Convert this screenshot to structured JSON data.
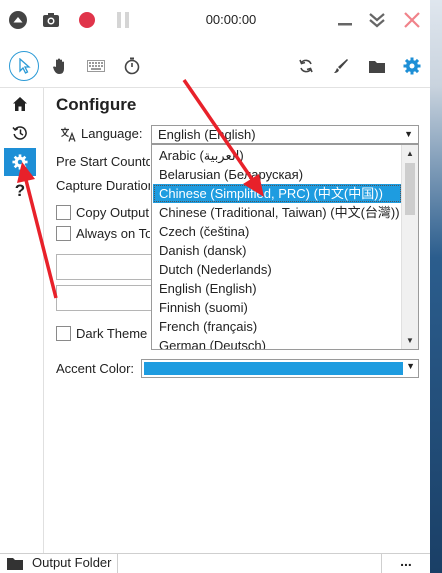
{
  "timer": "00:00:00",
  "page_title": "Configure",
  "language": {
    "label": "Language:",
    "selected": "English (English)",
    "options": [
      "Arabic (العربية)",
      "Belarusian (Беларуская)",
      "Chinese (Simplified, PRC) (中文(中国))",
      "Chinese (Traditional, Taiwan) (中文(台灣))",
      "Czech (čeština)",
      "Danish (dansk)",
      "Dutch (Nederlands)",
      "English (English)",
      "Finnish (suomi)",
      "French (français)",
      "German (Deutsch)"
    ],
    "highlighted_index": 2
  },
  "settings": {
    "pre_start": "Pre Start Countdown",
    "capture_duration": "Capture Duration",
    "copy_output": "Copy Output",
    "always_on_top": "Always on Top",
    "dark_theme": "Dark Theme",
    "accent_color": "Accent Color:"
  },
  "colors": {
    "accent": "#1e9ce0",
    "record": "#e0344a",
    "close": "#f0828a",
    "arrow": "#e8212a"
  },
  "bottom": {
    "output_folder": "Output Folder",
    "more": "..."
  },
  "icons": [
    "up-icon",
    "camera-icon",
    "record-icon",
    "pause-icon",
    "minimize-icon",
    "collapse-icon",
    "close-icon",
    "pointer-icon",
    "hand-icon",
    "keyboard-icon",
    "timer-icon",
    "refresh-icon",
    "brush-icon",
    "folder-icon",
    "settings-icon",
    "home-icon",
    "history-icon",
    "help-icon",
    "translate-icon"
  ]
}
